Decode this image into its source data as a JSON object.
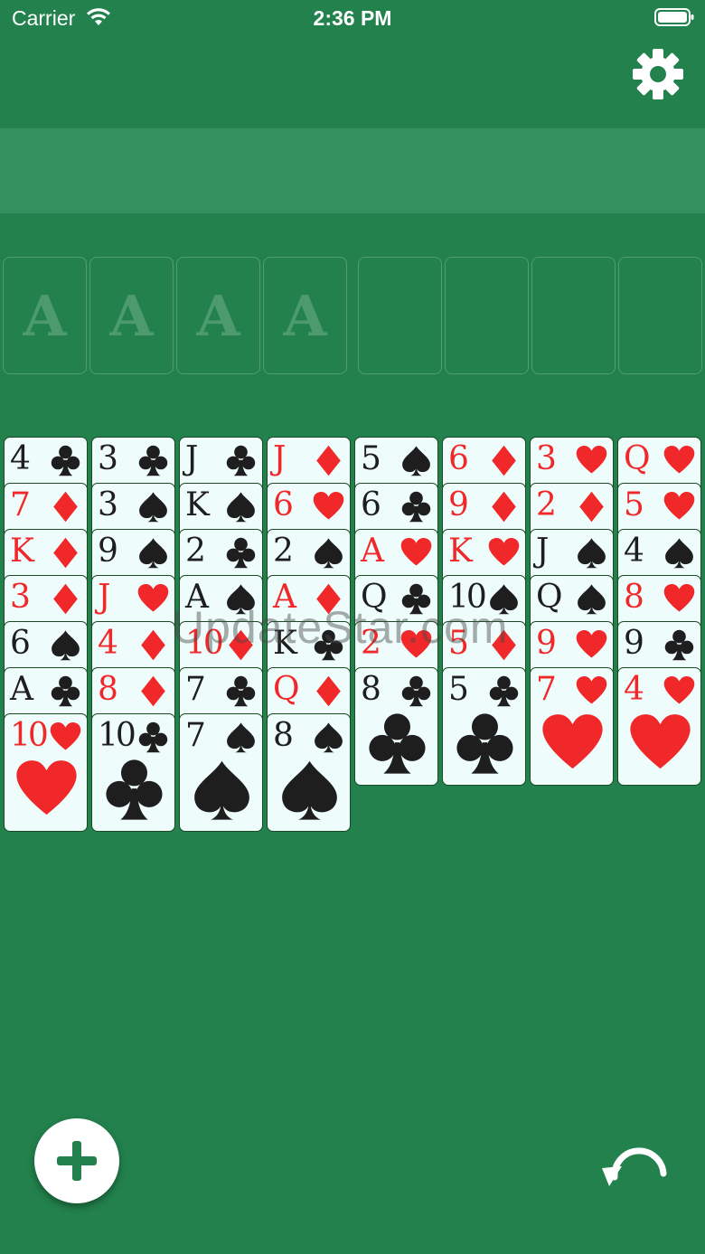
{
  "status_bar": {
    "carrier": "Carrier",
    "time": "2:36 PM"
  },
  "toolbar": {
    "settings_icon": "gear-icon",
    "new_game_icon": "plus-icon",
    "undo_icon": "undo-icon"
  },
  "foundations": [
    {
      "label": "A"
    },
    {
      "label": "A"
    },
    {
      "label": "A"
    },
    {
      "label": "A"
    }
  ],
  "free_cells": [
    {},
    {},
    {},
    {}
  ],
  "tableau": [
    [
      {
        "rank": "4",
        "suit": "clubs"
      },
      {
        "rank": "7",
        "suit": "diamonds"
      },
      {
        "rank": "K",
        "suit": "diamonds"
      },
      {
        "rank": "3",
        "suit": "diamonds"
      },
      {
        "rank": "6",
        "suit": "spades"
      },
      {
        "rank": "A",
        "suit": "clubs"
      },
      {
        "rank": "10",
        "suit": "hearts"
      }
    ],
    [
      {
        "rank": "3",
        "suit": "clubs"
      },
      {
        "rank": "3",
        "suit": "spades"
      },
      {
        "rank": "9",
        "suit": "spades"
      },
      {
        "rank": "J",
        "suit": "hearts"
      },
      {
        "rank": "4",
        "suit": "diamonds"
      },
      {
        "rank": "8",
        "suit": "diamonds"
      },
      {
        "rank": "10",
        "suit": "clubs"
      }
    ],
    [
      {
        "rank": "J",
        "suit": "clubs"
      },
      {
        "rank": "K",
        "suit": "spades"
      },
      {
        "rank": "2",
        "suit": "clubs"
      },
      {
        "rank": "A",
        "suit": "spades"
      },
      {
        "rank": "10",
        "suit": "diamonds"
      },
      {
        "rank": "7",
        "suit": "clubs"
      },
      {
        "rank": "7",
        "suit": "spades"
      }
    ],
    [
      {
        "rank": "J",
        "suit": "diamonds"
      },
      {
        "rank": "6",
        "suit": "hearts"
      },
      {
        "rank": "2",
        "suit": "spades"
      },
      {
        "rank": "A",
        "suit": "diamonds"
      },
      {
        "rank": "K",
        "suit": "clubs"
      },
      {
        "rank": "Q",
        "suit": "diamonds"
      },
      {
        "rank": "8",
        "suit": "spades"
      }
    ],
    [
      {
        "rank": "5",
        "suit": "spades"
      },
      {
        "rank": "6",
        "suit": "clubs"
      },
      {
        "rank": "A",
        "suit": "hearts"
      },
      {
        "rank": "Q",
        "suit": "clubs"
      },
      {
        "rank": "2",
        "suit": "hearts"
      },
      {
        "rank": "8",
        "suit": "clubs"
      }
    ],
    [
      {
        "rank": "6",
        "suit": "diamonds"
      },
      {
        "rank": "9",
        "suit": "diamonds"
      },
      {
        "rank": "K",
        "suit": "hearts"
      },
      {
        "rank": "10",
        "suit": "spades"
      },
      {
        "rank": "5",
        "suit": "diamonds"
      },
      {
        "rank": "5",
        "suit": "clubs"
      }
    ],
    [
      {
        "rank": "3",
        "suit": "hearts"
      },
      {
        "rank": "2",
        "suit": "diamonds"
      },
      {
        "rank": "J",
        "suit": "spades"
      },
      {
        "rank": "Q",
        "suit": "spades"
      },
      {
        "rank": "9",
        "suit": "hearts"
      },
      {
        "rank": "7",
        "suit": "hearts"
      }
    ],
    [
      {
        "rank": "Q",
        "suit": "hearts"
      },
      {
        "rank": "5",
        "suit": "hearts"
      },
      {
        "rank": "4",
        "suit": "spades"
      },
      {
        "rank": "8",
        "suit": "hearts"
      },
      {
        "rank": "9",
        "suit": "clubs"
      },
      {
        "rank": "4",
        "suit": "hearts"
      }
    ]
  ],
  "colors": {
    "felt": "#22814c",
    "banner": "#34915f",
    "card_face": "#eefdfb",
    "red_suit": "#f0282a",
    "black_suit": "#1e1e1e"
  },
  "watermark": "UpdateStar.com"
}
